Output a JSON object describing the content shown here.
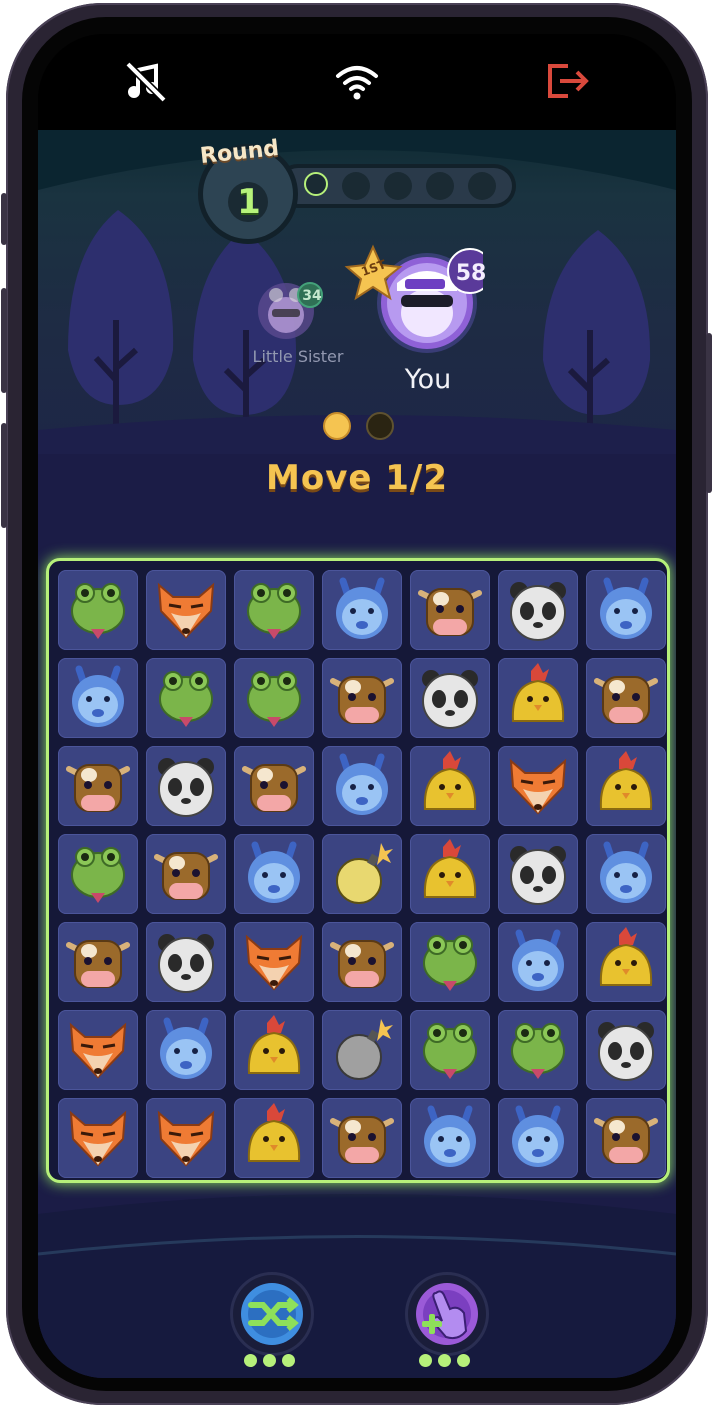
{
  "status_bar": {
    "icons": [
      "music-off-icon",
      "wifi-icon",
      "exit-icon"
    ],
    "exit_color": "#d9493c"
  },
  "round": {
    "label": "Round",
    "number": "1",
    "total_steps": 5,
    "current_step": 1
  },
  "players": [
    {
      "name": "Little Sister",
      "score": "34",
      "active": false
    },
    {
      "name": "You",
      "score": "58",
      "rank_badge": "1ST",
      "active": true
    }
  ],
  "moves": {
    "text": "Move 1/2",
    "dots": [
      true,
      false
    ]
  },
  "board": {
    "rows": [
      [
        "frog",
        "fox",
        "frog",
        "llama",
        "cow",
        "panda",
        "llama"
      ],
      [
        "llama",
        "frog",
        "frog",
        "cow",
        "panda",
        "chick",
        "cow"
      ],
      [
        "cow",
        "panda",
        "cow",
        "llama",
        "chick",
        "fox",
        "chick"
      ],
      [
        "frog",
        "cow",
        "llama",
        "bomb-gold",
        "chick",
        "panda",
        "llama"
      ],
      [
        "cow",
        "panda",
        "fox",
        "cow",
        "frog",
        "llama",
        "chick"
      ],
      [
        "fox",
        "llama",
        "chick",
        "bomb",
        "frog",
        "frog",
        "panda"
      ],
      [
        "fox",
        "fox",
        "chick",
        "cow",
        "llama",
        "llama",
        "cow"
      ]
    ],
    "highlight_color": "#b6f07a"
  },
  "powerups": [
    {
      "name": "shuffle-icon",
      "charges": 3
    },
    {
      "name": "hand-swap-icon",
      "charges": 3
    }
  ]
}
